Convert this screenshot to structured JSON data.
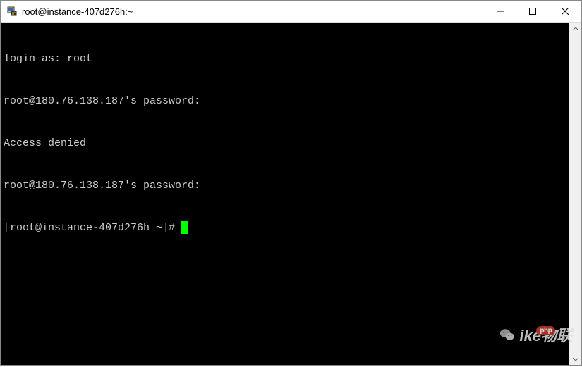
{
  "window": {
    "title": "root@instance-407d276h:~"
  },
  "terminal": {
    "lines": [
      "login as: root",
      "root@180.76.138.187's password:",
      "Access denied",
      "root@180.76.138.187's password:"
    ],
    "prompt": "[root@instance-407d276h ~]# "
  },
  "watermark": {
    "text": "ike物联",
    "badge": "php"
  }
}
